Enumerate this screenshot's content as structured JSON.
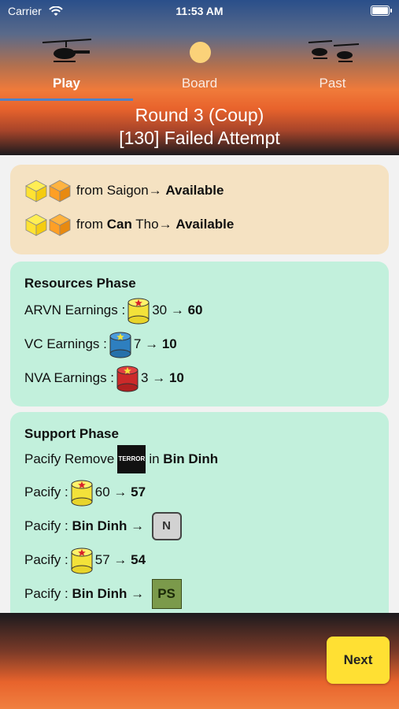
{
  "status_bar": {
    "carrier": "Carrier",
    "time": "11:53 AM"
  },
  "tabs": [
    {
      "label": "Play",
      "icon": "helicopter-icon",
      "selected": true
    },
    {
      "label": "Board",
      "icon": "sun-icon",
      "selected": false
    },
    {
      "label": "Past",
      "icon": "helicopters-icon",
      "selected": false
    }
  ],
  "header": {
    "line1": "Round 3 (Coup)",
    "line2": "[130] Failed Attempt"
  },
  "transfers": {
    "row1": {
      "text": "from Saigon→",
      "dest": "Available"
    },
    "row2": {
      "pre": "from ",
      "bold": "Can",
      "post": " Tho→",
      "dest": "Available"
    }
  },
  "resources": {
    "title": "Resources Phase",
    "arvn": {
      "label": "ARVN Earnings :",
      "from": "30",
      "arrow": "→",
      "to": "60"
    },
    "vc": {
      "label": "VC Earnings :",
      "from": "7",
      "arrow": "→",
      "to": "10"
    },
    "nva": {
      "label": "NVA Earnings :",
      "from": "3",
      "arrow": "→",
      "to": "10"
    }
  },
  "support": {
    "title": "Support Phase",
    "row1": {
      "pre": "Pacify Remove",
      "marker": "TERROR",
      "mid": "in",
      "place": "Bin Dinh"
    },
    "row2": {
      "label": "Pacify :",
      "from": "60",
      "arrow": "→",
      "to": "57"
    },
    "row3": {
      "label": "Pacify :",
      "place": "Bin Dinh",
      "arrow": "→",
      "marker": "N"
    },
    "row4": {
      "label": "Pacify :",
      "from": "57",
      "arrow": "→",
      "to": "54"
    },
    "row5": {
      "label": "Pacify :",
      "place": "Bin Dinh",
      "arrow": "→",
      "marker": "PS"
    }
  },
  "footer": {
    "next_label": "Next"
  },
  "colors": {
    "accent_tab": "#4f82c7",
    "resource_card": "#c2f0dc",
    "transfer_card": "#f5e2c2",
    "next_button": "#ffe033"
  }
}
